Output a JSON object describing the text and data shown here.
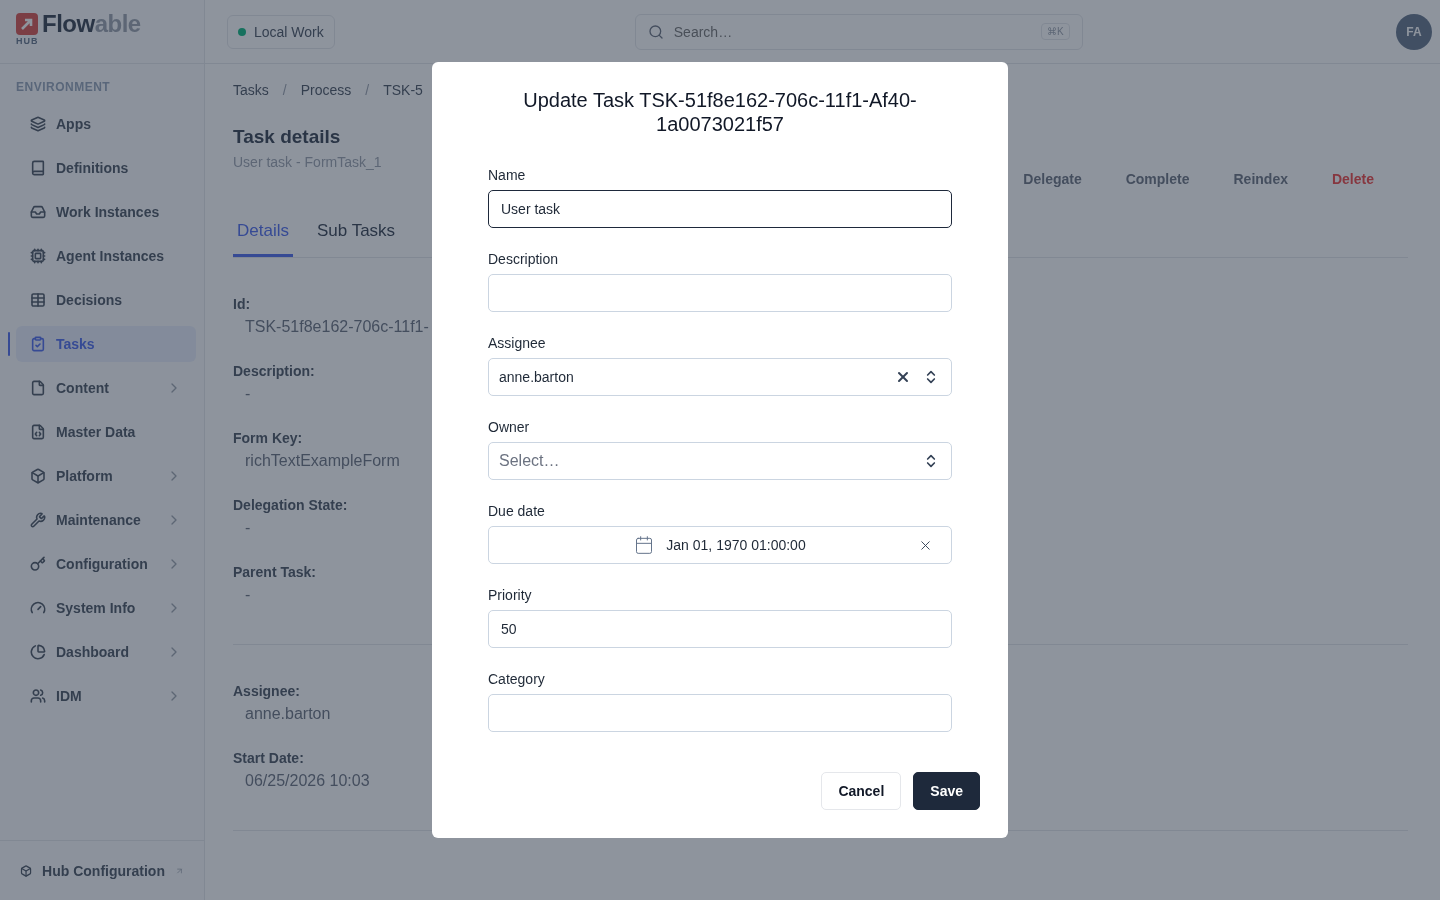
{
  "logo": {
    "parts": [
      "Flow",
      "able"
    ],
    "sub": "HUB"
  },
  "sidebar": {
    "section": "ENVIRONMENT",
    "items": [
      {
        "label": "Apps",
        "selected": false,
        "expandable": false
      },
      {
        "label": "Definitions",
        "selected": false,
        "expandable": false
      },
      {
        "label": "Work Instances",
        "selected": false,
        "expandable": false
      },
      {
        "label": "Agent Instances",
        "selected": false,
        "expandable": false
      },
      {
        "label": "Decisions",
        "selected": false,
        "expandable": false
      },
      {
        "label": "Tasks",
        "selected": true,
        "expandable": false
      },
      {
        "label": "Content",
        "selected": false,
        "expandable": true
      },
      {
        "label": "Master Data",
        "selected": false,
        "expandable": false
      },
      {
        "label": "Platform",
        "selected": false,
        "expandable": true
      },
      {
        "label": "Maintenance",
        "selected": false,
        "expandable": true
      },
      {
        "label": "Configuration",
        "selected": false,
        "expandable": true
      },
      {
        "label": "System Info",
        "selected": false,
        "expandable": true
      },
      {
        "label": "Dashboard",
        "selected": false,
        "expandable": true
      },
      {
        "label": "IDM",
        "selected": false,
        "expandable": true
      }
    ],
    "footer": "Hub Configuration"
  },
  "topbar": {
    "environment": "Local Work",
    "search": {
      "placeholder": "Search…",
      "shortcut": "⌘K"
    },
    "avatar": "FA"
  },
  "breadcrumb": {
    "separator": "/",
    "items": [
      "Tasks",
      "Process",
      "TSK-5"
    ]
  },
  "header": {
    "title": "Task details",
    "subtitle": "User task - FormTask_1",
    "actions": [
      {
        "label": "Delegate",
        "kind": "normal"
      },
      {
        "label": "Complete",
        "kind": "normal"
      },
      {
        "label": "Reindex",
        "kind": "normal"
      },
      {
        "label": "Delete",
        "kind": "danger"
      }
    ]
  },
  "tabs": [
    {
      "label": "Details",
      "selected": true
    },
    {
      "label": "Sub Tasks",
      "selected": false
    }
  ],
  "detail_groups": [
    [
      {
        "label": "Id:",
        "value": "TSK-51f8e162-706c-11f1-"
      },
      {
        "label": "Description:",
        "value": "-"
      },
      {
        "label": "Form Key:",
        "value": "richTextExampleForm"
      },
      {
        "label": "Delegation State:",
        "value": "-"
      },
      {
        "label": "Parent Task:",
        "value": "-"
      }
    ],
    [
      {
        "label": "Assignee:",
        "value": "anne.barton"
      },
      {
        "label": "Start Date:",
        "value": "06/25/2026 10:03"
      }
    ]
  ],
  "modal": {
    "title": "Update Task TSK-51f8e162-706c-11f1-Af40-1a0073021f57",
    "fields": [
      {
        "label": "Name",
        "kind": "text",
        "value": "User task",
        "focused": true
      },
      {
        "label": "Description",
        "kind": "text",
        "focused": false
      },
      {
        "label": "Assignee",
        "kind": "select",
        "value": "anne.barton",
        "clearable": true,
        "focused": false
      },
      {
        "label": "Owner",
        "kind": "select",
        "placeholder": "Select…",
        "clearable": false,
        "focused": false
      },
      {
        "label": "Due date",
        "kind": "date",
        "value": "Jan 01, 1970 01:00:00",
        "clearable": true,
        "focused": false
      },
      {
        "label": "Priority",
        "kind": "text",
        "value": "50",
        "focused": false
      },
      {
        "label": "Category",
        "kind": "text",
        "focused": false
      }
    ],
    "buttons": [
      {
        "label": "Cancel",
        "kind": "secondary"
      },
      {
        "label": "Save",
        "kind": "primary"
      }
    ]
  }
}
